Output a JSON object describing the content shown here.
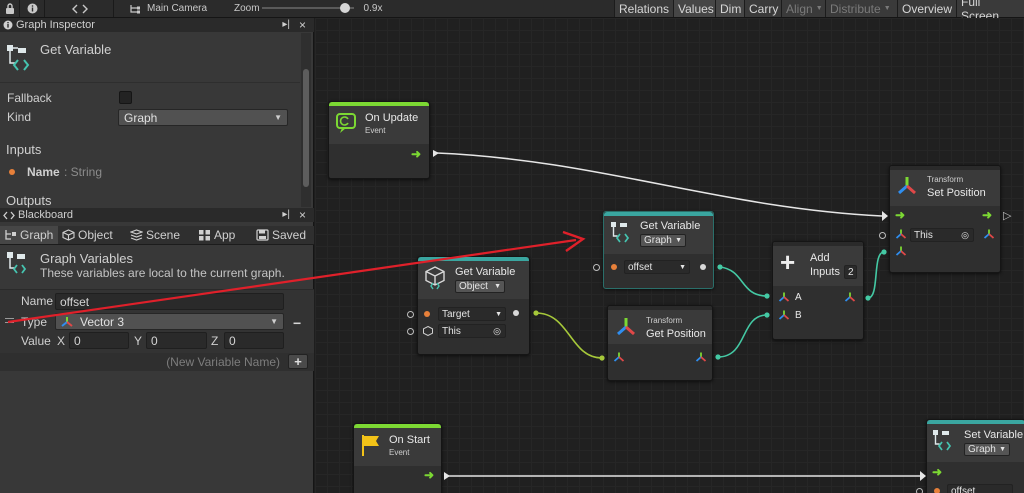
{
  "topbar": {
    "camera": "Main Camera",
    "zoom_label": "Zoom",
    "zoom_value": "0.9x",
    "zoom_fraction": 0.85,
    "buttons": [
      "Relations",
      "Values",
      "Dim",
      "Carry",
      "Align",
      "Distribute",
      "Overview",
      "Full Screen"
    ]
  },
  "inspector": {
    "header": "Graph Inspector",
    "node_title": "Get Variable",
    "fallback_label": "Fallback",
    "kind_label": "Kind",
    "kind_value": "Graph",
    "inputs_label": "Inputs",
    "input_name": "Name",
    "input_type": ": String",
    "outputs_label": "Outputs"
  },
  "blackboard": {
    "header": "Blackboard",
    "tabs": [
      "Graph",
      "Object",
      "Scene",
      "App",
      "Saved"
    ],
    "section_title": "Graph Variables",
    "section_desc": "These variables are local to the current graph.",
    "name_label": "Name",
    "name_value": "offset",
    "type_label": "Type",
    "type_value": "Vector 3",
    "value_label": "Value",
    "x_label": "X",
    "x_value": "0",
    "y_label": "Y",
    "y_value": "0",
    "z_label": "Z",
    "z_value": "0",
    "new_var_placeholder": "(New Variable Name)"
  },
  "nodes": {
    "on_update": {
      "title": "On Update",
      "subtitle": "Event"
    },
    "get_var_object": {
      "title": "Get Variable",
      "kind": "Object",
      "port_target": "Target",
      "port_this": "This"
    },
    "get_var_graph": {
      "title": "Get Variable",
      "kind": "Graph",
      "name_value": "offset"
    },
    "get_position": {
      "subtitle": "Transform",
      "title": "Get Position"
    },
    "add": {
      "title": "Add",
      "inputs_label": "Inputs",
      "inputs_value": "2",
      "port_a": "A",
      "port_b": "B"
    },
    "set_position": {
      "subtitle": "Transform",
      "title": "Set Position",
      "port_this": "This"
    },
    "on_start": {
      "title": "On Start",
      "subtitle": "Event"
    },
    "set_variable": {
      "title": "Set Variable",
      "kind": "Graph",
      "name_value": "offset"
    }
  },
  "colors": {
    "flow_green": "#7cd833",
    "event_bar": "#7cd833",
    "variable_bar": "#3aa6a0",
    "transform_bar": "#2a2a2a",
    "wire_teal": "#44c9a4",
    "wire_olive": "#a6c83a",
    "annotation_red": "#e0202a"
  }
}
